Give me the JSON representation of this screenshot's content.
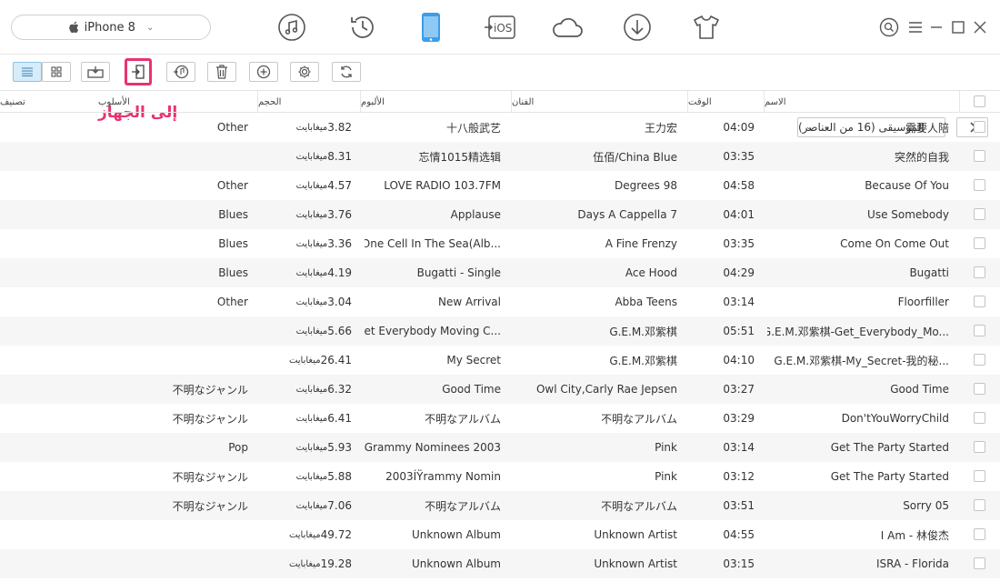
{
  "device": {
    "name": "iPhone 8"
  },
  "nav_icons": [
    "music-icon",
    "history-icon",
    "phone-icon",
    "to-ios-icon",
    "cloud-icon",
    "download-icon",
    "shirt-icon"
  ],
  "nav_ios_label": "iOS",
  "toolbar": {
    "callout_label": "إلى الجهاز",
    "category_label": "الموسيقى (16 من العناصر)"
  },
  "columns": {
    "name": "الاسم",
    "time": "الوقت",
    "artist": "الفنان",
    "album": "الألبوم",
    "size": "الحجم",
    "genre": "الأسلوب",
    "rating": "تصنيف"
  },
  "size_unit": "ميغابايت",
  "rows": [
    {
      "name": "需要人陪",
      "time": "04:09",
      "artist": "王力宏",
      "album": "十八般武艺",
      "size": "3.82",
      "genre": "Other"
    },
    {
      "name": "突然的自我",
      "time": "03:35",
      "artist": "伍佰/China Blue",
      "album": "忘情1015精选辑",
      "size": "8.31",
      "genre": ""
    },
    {
      "name": "Because Of You",
      "time": "04:58",
      "artist": "Degrees 98",
      "album": "LOVE RADIO 103.7FM",
      "size": "4.57",
      "genre": "Other"
    },
    {
      "name": "Use Somebody",
      "time": "04:01",
      "artist": "Days A Cappella 7",
      "album": "Applause",
      "size": "3.76",
      "genre": "Blues"
    },
    {
      "name": "Come On Come Out",
      "time": "03:35",
      "artist": "A Fine Frenzy",
      "album": "One Cell In The Sea(Alb...",
      "size": "3.36",
      "genre": "Blues"
    },
    {
      "name": "Bugatti",
      "time": "04:29",
      "artist": "Ace Hood",
      "album": "Bugatti - Single",
      "size": "4.19",
      "genre": "Blues"
    },
    {
      "name": "Floorfiller",
      "time": "03:14",
      "artist": "Abba Teens",
      "album": "New Arrival",
      "size": "3.04",
      "genre": "Other"
    },
    {
      "name": "G.E.M.邓紫棋-Get_Everybody_Mo...",
      "time": "05:51",
      "artist": "G.E.M.邓紫棋",
      "album": "Get Everybody Moving C...",
      "size": "5.66",
      "genre": ""
    },
    {
      "name": "G.E.M.邓紫棋-My_Secret-我的秘...",
      "time": "04:10",
      "artist": "G.E.M.邓紫棋",
      "album": "My Secret",
      "size": "26.41",
      "genre": ""
    },
    {
      "name": "Good Time",
      "time": "03:27",
      "artist": "Owl City,Carly Rae Jepsen",
      "album": "Good Time",
      "size": "6.32",
      "genre": "不明なジャンル"
    },
    {
      "name": "Don'tYouWorryChild",
      "time": "03:29",
      "artist": "不明なアルバム",
      "album": "不明なアルバム",
      "size": "6.41",
      "genre": "不明なジャンル"
    },
    {
      "name": "Get The Party Started",
      "time": "03:14",
      "artist": "Pink",
      "album": "Grammy Nominees 2003",
      "size": "5.93",
      "genre": "Pop"
    },
    {
      "name": "Get The Party Started",
      "time": "03:12",
      "artist": "Pink",
      "album": "2003ÍŸrammy Nomin",
      "size": "5.88",
      "genre": "不明なジャンル"
    },
    {
      "name": "Sorry 05",
      "time": "03:51",
      "artist": "不明なアルバム",
      "album": "不明なアルバム",
      "size": "7.06",
      "genre": "不明なジャンル"
    },
    {
      "name": "I Am - 林俊杰",
      "time": "04:55",
      "artist": "Unknown Artist",
      "album": "Unknown Album",
      "size": "49.72",
      "genre": ""
    },
    {
      "name": "ISRA - Florida",
      "time": "03:15",
      "artist": "Unknown Artist",
      "album": "Unknown Album",
      "size": "19.28",
      "genre": ""
    }
  ]
}
